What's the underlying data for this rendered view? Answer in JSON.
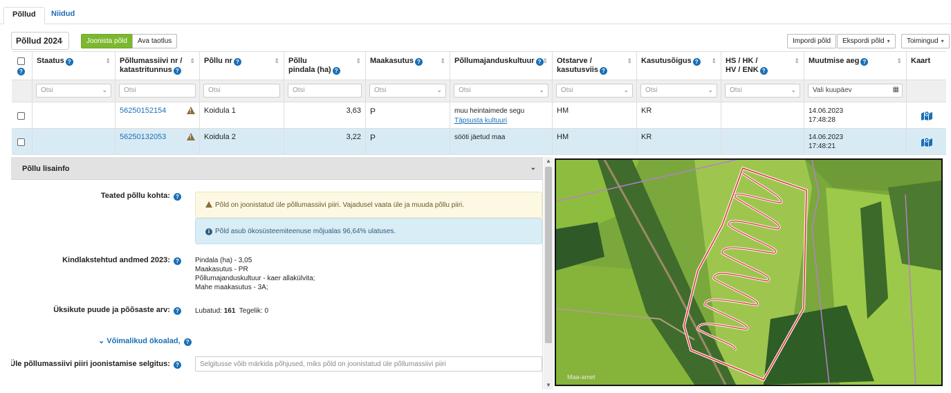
{
  "tabs": [
    {
      "label": "Põllud",
      "active": true
    },
    {
      "label": "Niidud",
      "active": false
    }
  ],
  "toolbar": {
    "year": "Põllud 2024",
    "draw_field": "Joonista põld",
    "open_application": "Ava taotlus",
    "import_field": "Impordi põld",
    "export_field": "Ekspordi põld",
    "actions": "Toimingud"
  },
  "columns": {
    "status": "Staatus",
    "massif_1": "Põllumassiivi nr /",
    "massif_2": "katastritunnus",
    "field_nr": "Põllu nr",
    "area_1": "Põllu",
    "area_2": "pindala (ha)",
    "land_use": "Maakasutus",
    "crop": "Põllumajanduskultuur",
    "purpose_1": "Otstarve /",
    "purpose_2": "kasutusviis",
    "right": "Kasutusõigus",
    "hs_1": "HS / HK /",
    "hs_2": "HV / ENK",
    "modified": "Muutmise aeg",
    "map": "Kaart"
  },
  "filters": {
    "search_placeholder": "Otsi",
    "date_placeholder": "Vali kuupäev"
  },
  "rows": [
    {
      "massif": "56250152154",
      "field_nr": "Koidula 1",
      "area": "3,63",
      "land_use": "P",
      "crop": "muu heintaimede segu",
      "crop_link": "Täpsusta kultuuri",
      "purpose": "HM",
      "right": "KR",
      "date": "14.06.2023",
      "time": "17:48:28",
      "selected": false
    },
    {
      "massif": "56250132053",
      "field_nr": "Koidula 2",
      "area": "3,22",
      "land_use": "P",
      "crop": "sööti jäetud maa",
      "crop_link": "",
      "purpose": "HM",
      "right": "KR",
      "date": "14.06.2023",
      "time": "17:48:21",
      "selected": true
    }
  ],
  "panel": {
    "title": "Põllu lisainfo",
    "notices_label": "Teated põllu kohta:",
    "warning_text": "Põld on joonistatud üle põllumassiivi piiri. Vajadusel vaata üle ja muuda põllu piiri.",
    "info_text": "Põld asub ökosüsteemiteenuse mõjualas 96,64% ulatuses.",
    "confirmed_label": "Kindlakstehtud andmed 2023:",
    "confirmed_lines": [
      "Pindala (ha) - 3,05",
      "Maakasutus - PR",
      "Põllumajanduskultuur - kaer allakülvita;",
      "Mahe maakasutus - 3A;"
    ],
    "trees_label": "Üksikute puude ja põõsaste arv:",
    "trees_allowed_label": "Lubatud:",
    "trees_allowed": "161",
    "trees_actual_label": "Tegelik:",
    "trees_actual": "0",
    "eco_areas": "Võimalikud ökoalad,",
    "explain_label": "Üle põllumassiivi piiri joonistamise selgitus:",
    "explain_placeholder": "Selgitusse võib märkida põhjused, miks põld on joonistatud üle põllumassiivi piiri"
  },
  "map": {
    "credit": "Maa-amet"
  },
  "colors": {
    "link": "#1a6fb5",
    "green_button": "#7cb82f",
    "selected_row": "#d8ebf5",
    "field_outline": "#e0302a"
  }
}
